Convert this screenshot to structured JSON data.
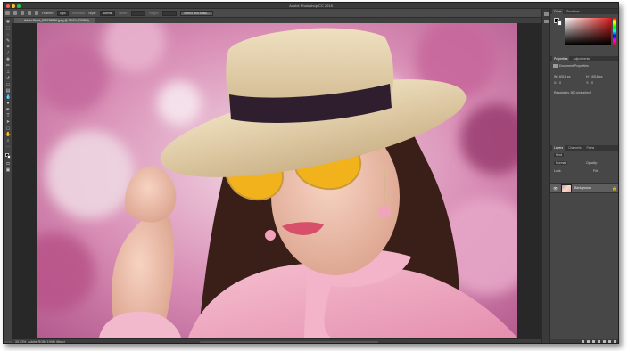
{
  "window": {
    "title": "Adobe Photoshop CC 2018"
  },
  "options_bar": {
    "feather_label": "Feather:",
    "feather_value": "0 px",
    "antialias_label": "Anti-alias",
    "style_label": "Style:",
    "style_value": "Normal",
    "width_label": "Width:",
    "height_label": "Height:",
    "select_mask_button": "Select and Mask..."
  },
  "document_tab": {
    "close_glyph": "×",
    "label": "AdobeStock_205786252.jpeg @ 33.3% (RGB/8)"
  },
  "status_bar": {
    "zoom": "33.33%",
    "doc_info": "Adobe RGB (1998) (8bpc)"
  },
  "color_panel": {
    "tabs": [
      "Color",
      "Swatches"
    ]
  },
  "properties_panel": {
    "tabs": [
      "Properties",
      "Adjustments"
    ],
    "section_title": "Document Properties",
    "w_label": "W:",
    "w_value": "6016 px",
    "h_label": "H:",
    "h_value": "4016 px",
    "x_label": "X:",
    "x_value": "0",
    "y_label": "Y:",
    "y_value": "0",
    "resolution": "Resolution: 300 pixels/inch"
  },
  "layers_panel": {
    "tabs": [
      "Layers",
      "Channels",
      "Paths"
    ],
    "filter_label": "Kind",
    "blend_mode": "Normal",
    "opacity_label": "Opacity:",
    "fill_label": "Fill:",
    "lock_label": "Lock:",
    "layers": [
      {
        "name": "Background",
        "visible": true,
        "locked": true
      }
    ]
  },
  "colors": {
    "chrome": "#535353",
    "panel": "#474747",
    "canvas_bg": "#282828",
    "sunglasses": "#f2b21b",
    "blouse": "#f0a8c0",
    "hat_band": "#2f1e2e"
  },
  "icons": {
    "tools": [
      "move-icon",
      "marquee-icon",
      "lasso-icon",
      "quick-select-icon",
      "crop-icon",
      "eyedropper-icon",
      "healing-icon",
      "brush-icon",
      "stamp-icon",
      "history-brush-icon",
      "eraser-icon",
      "gradient-icon",
      "blur-icon",
      "dodge-icon",
      "pen-icon",
      "type-icon",
      "path-select-icon",
      "shape-icon",
      "hand-icon",
      "zoom-icon"
    ]
  }
}
